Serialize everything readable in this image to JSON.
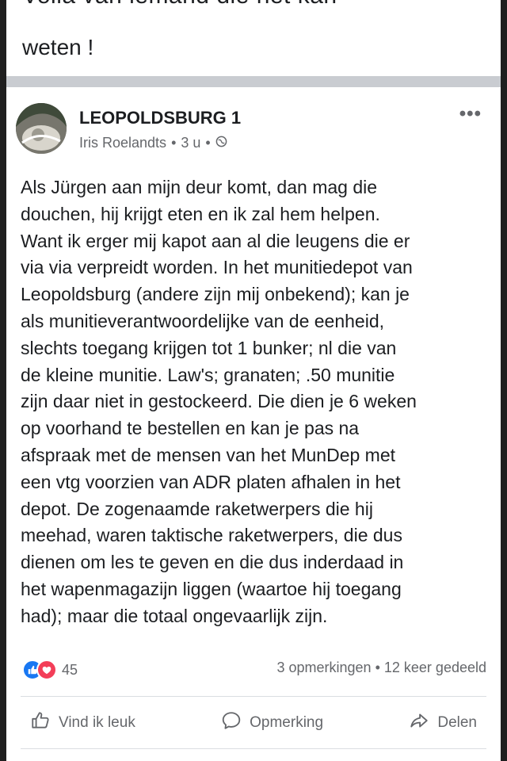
{
  "previous_post": {
    "cut_line": "Volla van iemand die het kan",
    "last_line": "weten !"
  },
  "post": {
    "group_name": "LEOPOLDSBURG 1",
    "author": "Iris Roelandts",
    "time": "3 u",
    "body": "Als Jürgen aan mijn deur komt, dan mag die\ndouchen, hij krijgt eten en ik zal hem helpen.\nWant ik erger mij kapot aan al die leugens die er\nvia via verpreidt worden.  In het munitiedepot van\nLeopoldsburg (andere zijn mij onbekend); kan je\nals munitieverantwoordelijke van de eenheid,\nslechts toegang krijgen tot 1 bunker; nl die van\nde kleine munitie. Law's; granaten; .50 munitie\nzijn daar niet in gestockeerd. Die dien je 6 weken\nop voorhand te bestellen en kan je pas na\nafspraak met de mensen van het MunDep met\neen vtg voorzien van ADR platen afhalen in het\ndepot. De zogenaamde raketwerpers die hij\nmeehad, waren taktische raketwerpers, die dus\ndienen om les te geven en die dus inderdaad in\nhet wapenmagazijn liggen (waartoe hij toegang\nhad); maar die totaal ongevaarlijk zijn.",
    "reaction_count": "45",
    "comments": "3 opmerkingen",
    "shares": "12 keer gedeeld"
  },
  "actions": {
    "like": "Vind ik leuk",
    "comment": "Opmerking",
    "share": "Delen"
  },
  "colors": {
    "like_blue": "#1877f2",
    "love_red": "#f33e58",
    "text": "#1c1e21",
    "muted": "#65676b"
  },
  "icons": [
    "more-options-icon",
    "globe-icon",
    "like-reaction-icon",
    "love-reaction-icon",
    "thumbs-up-icon",
    "comment-icon",
    "share-icon"
  ]
}
